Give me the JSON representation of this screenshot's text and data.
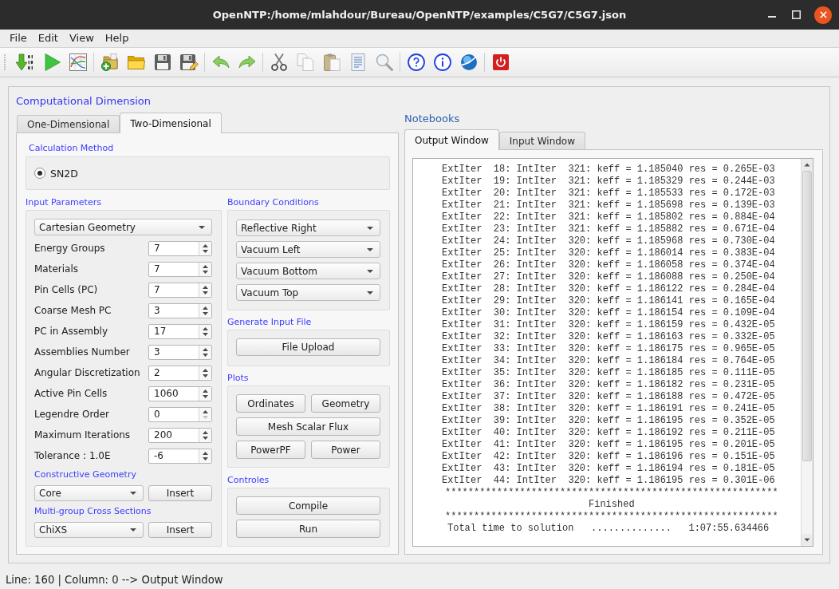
{
  "window": {
    "title": "OpenNTP:/home/mlahdour/Bureau/OpenNTP/examples/C5G7/C5G7.json"
  },
  "menu": [
    "File",
    "Edit",
    "View",
    "Help"
  ],
  "computational_dimension": {
    "title": "Computational Dimension",
    "tabs": [
      {
        "label": "One-Dimensional",
        "selected": false
      },
      {
        "label": "Two-Dimensional",
        "selected": true
      }
    ],
    "calculation_method": {
      "title": "Calculation Method",
      "options": [
        {
          "label": "SN2D",
          "selected": true
        }
      ]
    },
    "input_parameters": {
      "title": "Input Parameters",
      "geometry": "Cartesian Geometry",
      "fields": [
        {
          "label": "Energy Groups",
          "value": "7",
          "down_disabled": false
        },
        {
          "label": "Materials",
          "value": "7",
          "down_disabled": false
        },
        {
          "label": "Pin Cells (PC)",
          "value": "7",
          "down_disabled": false
        },
        {
          "label": "Coarse Mesh PC",
          "value": "3",
          "down_disabled": false
        },
        {
          "label": "PC in Assembly",
          "value": "17",
          "down_disabled": false
        },
        {
          "label": "Assemblies Number",
          "value": "3",
          "down_disabled": false
        },
        {
          "label": "Angular Discretization",
          "value": "2",
          "down_disabled": false
        },
        {
          "label": "Active Pin Cells",
          "value": "1060",
          "down_disabled": false
        },
        {
          "label": "Legendre Order",
          "value": "0",
          "down_disabled": true
        },
        {
          "label": "Maximum Iterations",
          "value": "200",
          "down_disabled": false
        },
        {
          "label": "Tolerance : 1.0E",
          "value": "-6",
          "down_disabled": false
        }
      ],
      "constructive_geometry": {
        "title": "Constructive Geometry",
        "selection": "Core",
        "button": "Insert"
      },
      "cross_sections": {
        "title": "Multi-group Cross Sections",
        "selection": "ChiXS",
        "button": "Insert"
      }
    },
    "boundary_conditions": {
      "title": "Boundary Conditions",
      "selections": [
        "Reflective Right",
        "Vacuum Left",
        "Vacuum Bottom",
        "Vacuum Top"
      ]
    },
    "generate_input_file": {
      "title": "Generate Input File",
      "buttons": [
        "File Upload"
      ]
    },
    "plots": {
      "title": "Plots",
      "buttons": [
        {
          "label": "Ordinates",
          "kind": "half"
        },
        {
          "label": "Geometry",
          "kind": "half"
        },
        {
          "label": "Mesh Scalar Flux",
          "kind": "full"
        },
        {
          "label": "PowerPF",
          "kind": "half"
        },
        {
          "label": "Power",
          "kind": "half"
        }
      ]
    },
    "controls": {
      "title": "Controles",
      "buttons": [
        "Compile",
        "Run"
      ]
    }
  },
  "notebooks": {
    "title": "Notebooks",
    "tabs": [
      {
        "label": "Output Window",
        "selected": true
      },
      {
        "label": "Input Window",
        "selected": false
      }
    ],
    "output": [
      {
        "kind": "log",
        "text": "ExtIter  18: IntIter  321: keff = 1.185040 res = 0.265E-03"
      },
      {
        "kind": "log",
        "text": "ExtIter  19: IntIter  321: keff = 1.185329 res = 0.244E-03"
      },
      {
        "kind": "log",
        "text": "ExtIter  20: IntIter  321: keff = 1.185533 res = 0.172E-03"
      },
      {
        "kind": "log",
        "text": "ExtIter  21: IntIter  321: keff = 1.185698 res = 0.139E-03"
      },
      {
        "kind": "log",
        "text": "ExtIter  22: IntIter  321: keff = 1.185802 res = 0.884E-04"
      },
      {
        "kind": "log",
        "text": "ExtIter  23: IntIter  321: keff = 1.185882 res = 0.671E-04"
      },
      {
        "kind": "log",
        "text": "ExtIter  24: IntIter  320: keff = 1.185968 res = 0.730E-04"
      },
      {
        "kind": "log",
        "text": "ExtIter  25: IntIter  320: keff = 1.186014 res = 0.383E-04"
      },
      {
        "kind": "log",
        "text": "ExtIter  26: IntIter  320: keff = 1.186058 res = 0.374E-04"
      },
      {
        "kind": "log",
        "text": "ExtIter  27: IntIter  320: keff = 1.186088 res = 0.250E-04"
      },
      {
        "kind": "log",
        "text": "ExtIter  28: IntIter  320: keff = 1.186122 res = 0.284E-04"
      },
      {
        "kind": "log",
        "text": "ExtIter  29: IntIter  320: keff = 1.186141 res = 0.165E-04"
      },
      {
        "kind": "log",
        "text": "ExtIter  30: IntIter  320: keff = 1.186154 res = 0.109E-04"
      },
      {
        "kind": "log",
        "text": "ExtIter  31: IntIter  320: keff = 1.186159 res = 0.432E-05"
      },
      {
        "kind": "log",
        "text": "ExtIter  32: IntIter  320: keff = 1.186163 res = 0.332E-05"
      },
      {
        "kind": "log",
        "text": "ExtIter  33: IntIter  320: keff = 1.186175 res = 0.965E-05"
      },
      {
        "kind": "log",
        "text": "ExtIter  34: IntIter  320: keff = 1.186184 res = 0.764E-05"
      },
      {
        "kind": "log",
        "text": "ExtIter  35: IntIter  320: keff = 1.186185 res = 0.111E-05"
      },
      {
        "kind": "log",
        "text": "ExtIter  36: IntIter  320: keff = 1.186182 res = 0.231E-05"
      },
      {
        "kind": "log",
        "text": "ExtIter  37: IntIter  320: keff = 1.186188 res = 0.472E-05"
      },
      {
        "kind": "log",
        "text": "ExtIter  38: IntIter  320: keff = 1.186191 res = 0.241E-05"
      },
      {
        "kind": "log",
        "text": "ExtIter  39: IntIter  320: keff = 1.186195 res = 0.352E-05"
      },
      {
        "kind": "log",
        "text": "ExtIter  40: IntIter  320: keff = 1.186192 res = 0.211E-05"
      },
      {
        "kind": "log",
        "text": "ExtIter  41: IntIter  320: keff = 1.186195 res = 0.201E-05"
      },
      {
        "kind": "log",
        "text": "ExtIter  42: IntIter  320: keff = 1.186196 res = 0.151E-05"
      },
      {
        "kind": "log",
        "text": "ExtIter  43: IntIter  320: keff = 1.186194 res = 0.181E-05"
      },
      {
        "kind": "log",
        "text": "ExtIter  44: IntIter  320: keff = 1.186195 res = 0.301E-06"
      },
      {
        "kind": "rule",
        "text": "**********************************************************"
      },
      {
        "kind": "heading",
        "text": "Finished"
      },
      {
        "kind": "rule",
        "text": "**********************************************************"
      },
      {
        "kind": "summary",
        "text": "Total time to solution   ..............   1:07:55.634466"
      }
    ]
  },
  "status_bar": {
    "text": "Line: 160 | Column: 0 --> Output Window"
  }
}
